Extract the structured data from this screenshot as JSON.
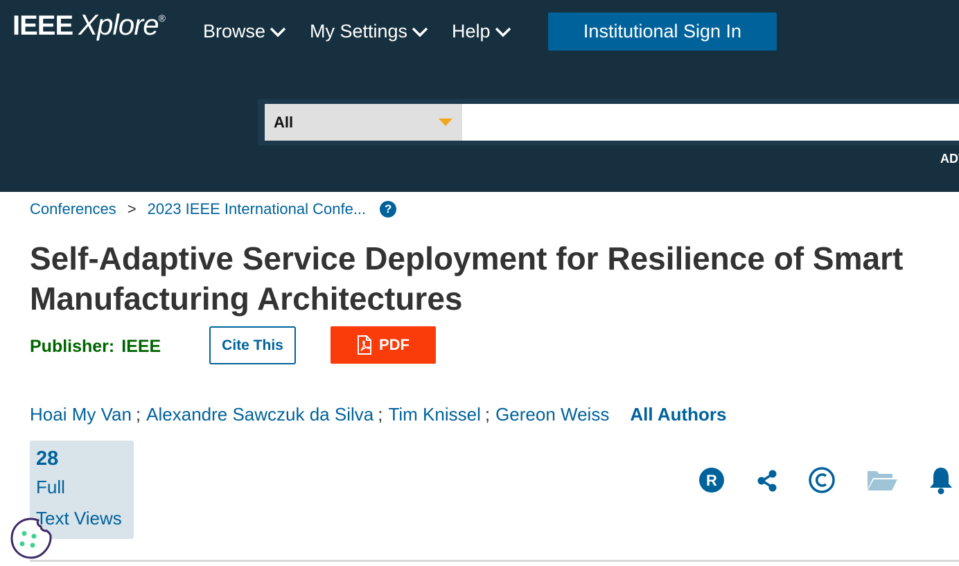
{
  "header": {
    "logo_ieee": "IEEE",
    "logo_xplore": "Xplore",
    "logo_reg": "®",
    "nav": {
      "browse": "Browse",
      "settings": "My Settings",
      "help": "Help"
    },
    "signin": "Institutional Sign In",
    "search": {
      "scope": "All",
      "placeholder": ""
    },
    "advanced": "ADV"
  },
  "breadcrumb": {
    "item1": "Conferences",
    "separator": ">",
    "item2": "2023 IEEE International Confe...",
    "help": "?"
  },
  "article": {
    "title": "Self-Adaptive Service Deployment for Resilience of Smart Manufacturing Architectures",
    "publisher_label": "Publisher:",
    "publisher_value": "IEEE",
    "cite_label": "Cite This",
    "pdf_label": "PDF"
  },
  "authors": {
    "list": [
      "Hoai My Van",
      "Alexandre Sawczuk da Silva",
      "Tim Knissel",
      "Gereon Weiss"
    ],
    "separator": ";",
    "all_label": "All Authors"
  },
  "metrics": {
    "count": "28",
    "label_line1": "Full",
    "label_line2": "Text Views"
  },
  "actions": {
    "rights_icon": "registered-icon",
    "share_icon": "share-icon",
    "copyright_icon": "copyright-icon",
    "folder_icon": "folder-open-icon",
    "alert_icon": "bell-icon"
  },
  "colors": {
    "header_bg": "#16303f",
    "brand_blue": "#00629b",
    "pdf_red": "#fa3b0a",
    "publisher_green": "#006400",
    "caret_orange": "#f0a81a"
  }
}
